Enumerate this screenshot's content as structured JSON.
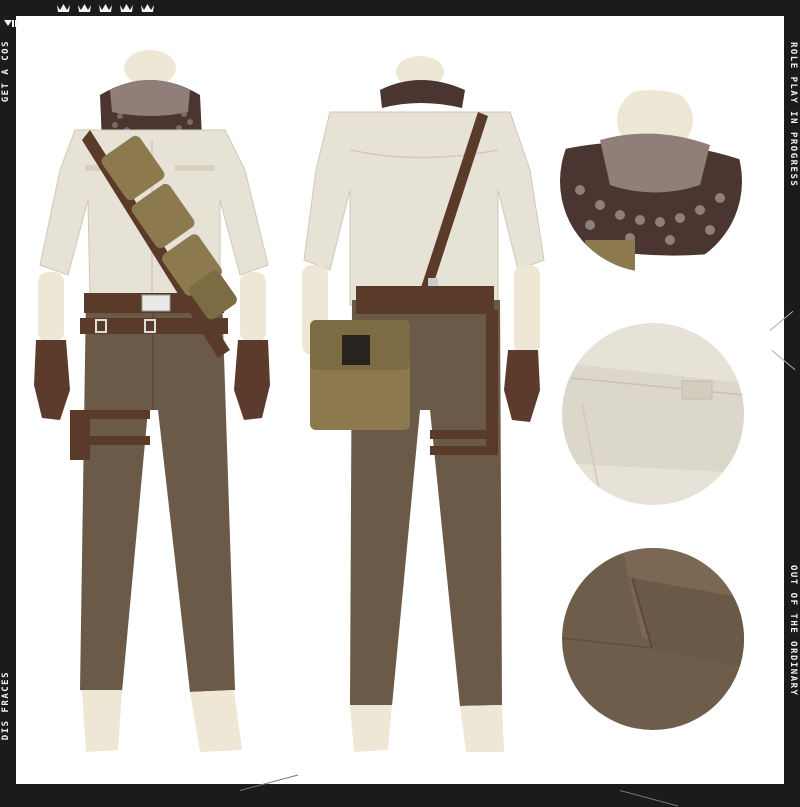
{
  "side_labels": {
    "left_top": "GET A COS",
    "left_bottom": "DIS FRACES",
    "right_top": "ROLE PLAY IN PROGRESS",
    "right_bottom": "OUT OF THE ORDINARY"
  },
  "crown_count": 5,
  "colors": {
    "border": "#1b1b1b",
    "shirt": "#e7e2d6",
    "pants": "#6b5a47",
    "belt": "#5a3a28",
    "pouch": "#8c7a4e",
    "scarf_dark": "#4a3530",
    "scarf_light": "#8f7f78",
    "mannequin": "#efe7d6"
  }
}
